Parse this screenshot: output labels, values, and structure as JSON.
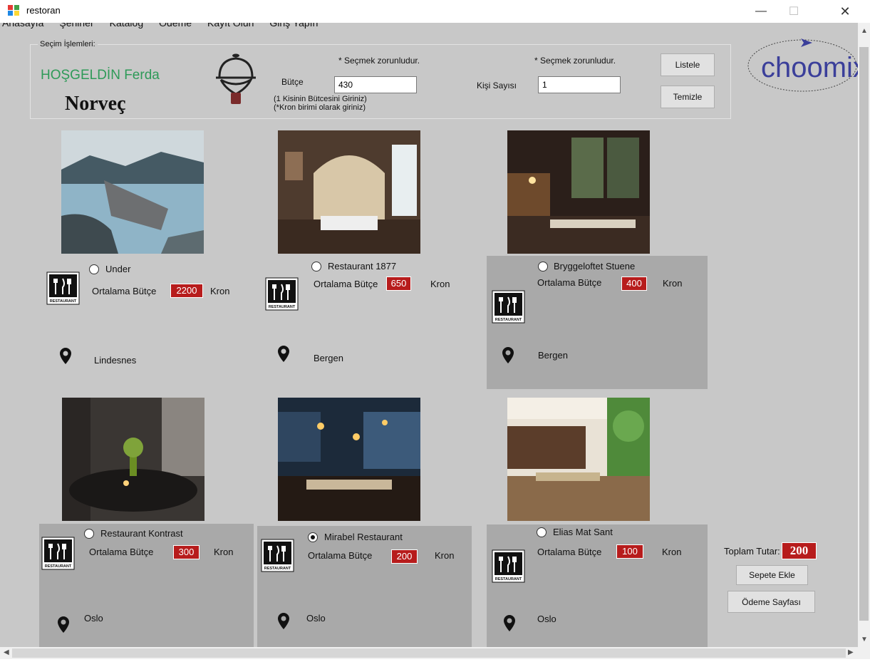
{
  "window": {
    "title": "restoran",
    "minimize": "—",
    "maximize": "☐",
    "close": "✕"
  },
  "menu": [
    "Anasayfa",
    "Şehirler",
    "Katalog",
    "Ödeme",
    "Kayıt Olun",
    "Giriş Yapın"
  ],
  "selection": {
    "legend": "Seçim İşlemleri:",
    "welcome": "HOŞGELDİN Ferda",
    "country": "Norveç",
    "budget_required": "* Seçmek zorunludur.",
    "budget_label": "Bütçe",
    "budget_value": "430",
    "budget_hint_1": "(1 Kisinin Bütcesini Giriniz)",
    "budget_hint_2": "(*Kron birimi olarak giriniz)",
    "people_required": "* Seçmek zorunludur.",
    "people_label": "Kişi Sayısı",
    "people_value": "1",
    "list_button": "Listele",
    "clear_button": "Temizle"
  },
  "logo_text": "choomix",
  "budget_label": "Ortalama Bütçe",
  "currency": "Kron",
  "restaurants": [
    {
      "name": "Under",
      "price": "2200",
      "city": "Lindesnes",
      "selected": false
    },
    {
      "name": "Restaurant 1877",
      "price": "650",
      "city": "Bergen",
      "selected": false
    },
    {
      "name": "Bryggeloftet Stuene",
      "price": "400",
      "city": "Bergen",
      "selected": false
    },
    {
      "name": "Restaurant Kontrast",
      "price": "300",
      "city": "Oslo",
      "selected": false
    },
    {
      "name": "Mirabel Restaurant",
      "price": "200",
      "city": "Oslo",
      "selected": true
    },
    {
      "name": "Elias Mat  Sant",
      "price": "100",
      "city": "Oslo",
      "selected": false
    }
  ],
  "icon_badge_text": "RESTAURANT",
  "cart": {
    "total_label": "Toplam Tutar:",
    "total_value": "200",
    "add_button": "Sepete Ekle",
    "pay_button": "Ödeme Sayfası"
  },
  "colors": {
    "accent_green": "#2e9a58",
    "price_red": "#b71c1c",
    "background": "#c8c8c8"
  }
}
